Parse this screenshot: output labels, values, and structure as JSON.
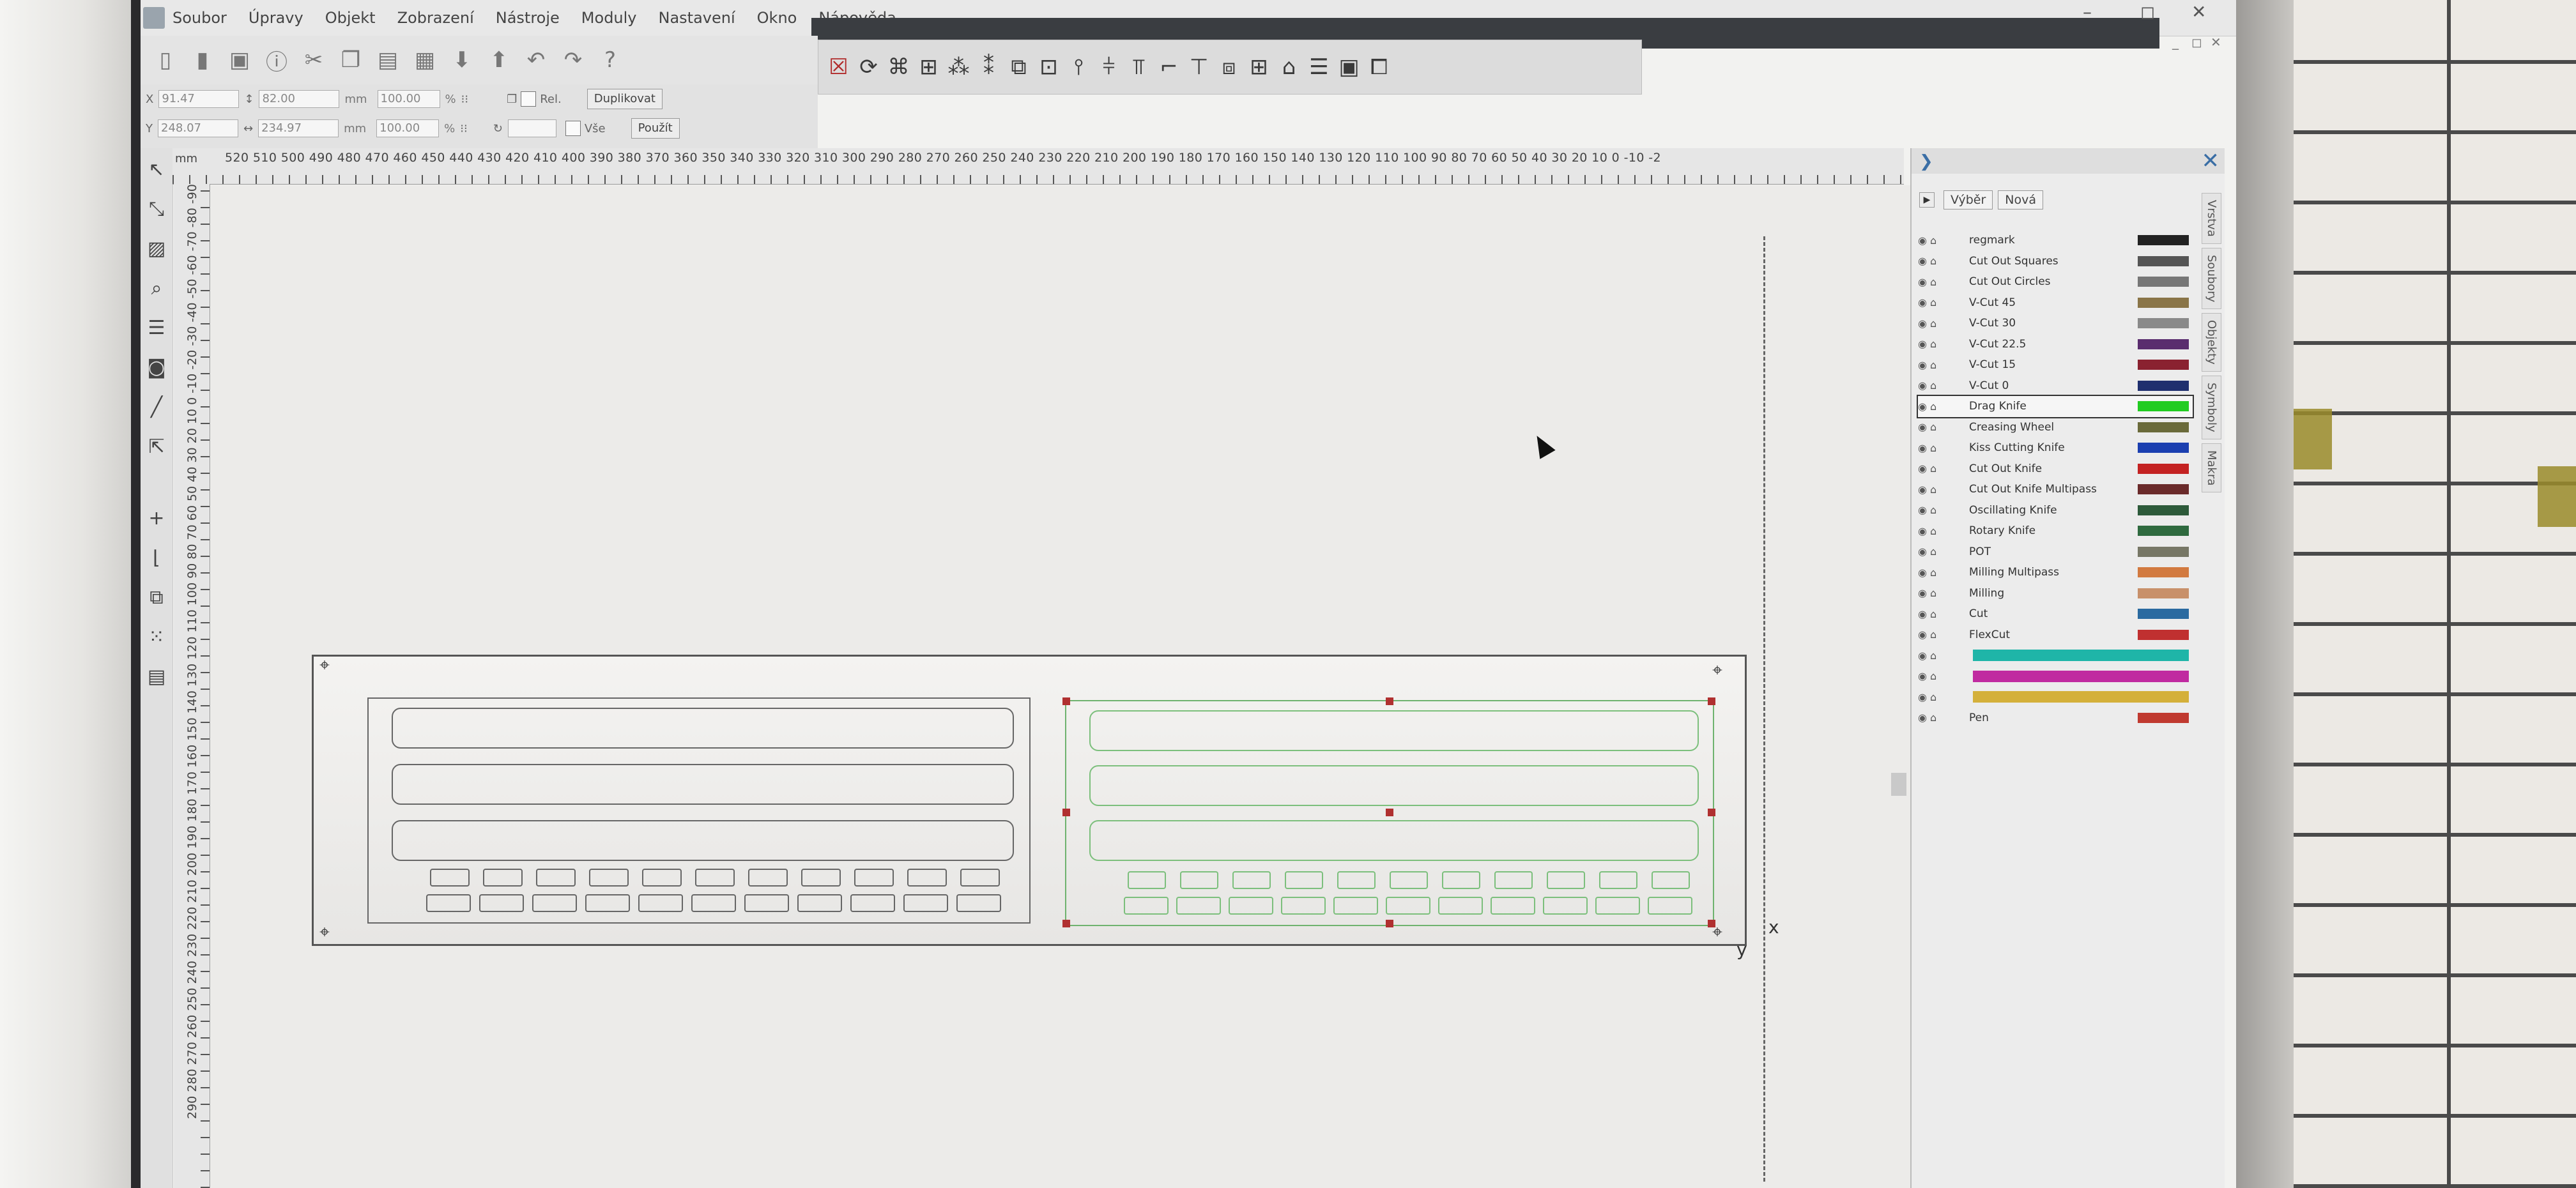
{
  "menu": [
    "Soubor",
    "Úpravy",
    "Objekt",
    "Zobrazení",
    "Nástroje",
    "Moduly",
    "Nastavení",
    "Okno",
    "Nápověda"
  ],
  "window_controls": [
    "–",
    "◻",
    "✕"
  ],
  "doc_controls": [
    "_",
    "◻",
    "✕"
  ],
  "props": {
    "x_label": "X",
    "x_value": "91.47",
    "y_label": "Y",
    "y_value": "248.07",
    "w_value": "82.00",
    "h_value": "234.97",
    "unit": "mm",
    "scale_w": "100.00",
    "scale_h": "100.00",
    "pct": "%",
    "rel_label": "Rel.",
    "all_label": "Vše",
    "duplicate_button": "Duplikovat",
    "apply_button": "Použít"
  },
  "ruler": {
    "unit": "mm",
    "h_numbers": "520 510 500 490 480 470 460 450 440 430 420 410 400 390 380 370 360 350 340 330 320 310 300 290 280 270 260 250 240 230 220 210 200 190 180 170 160 150 140 130 120 110 100 90 80 70 60 50 40 30 20 10 0 -10 -2",
    "v_numbers": "290 280 270 260 250 240 230 220 210 200 190 180 170 160 150 140 130 120 110 100 90 80 70 60 50 40 30 20 10 0 -10 -20 -30 -40 -50 -60 -70 -80 -90"
  },
  "canvas": {
    "axis_x": "x",
    "axis_y": "y"
  },
  "layers_panel": {
    "select_button": "Výběr",
    "new_button": "Nová",
    "tabs": [
      "Vrstva",
      "Soubory",
      "Objekty",
      "Symboly",
      "Makra"
    ],
    "layers": [
      {
        "name": "regmark",
        "color": "#222222"
      },
      {
        "name": "Cut Out Squares",
        "color": "#555555"
      },
      {
        "name": "Cut Out Circles",
        "color": "#777777"
      },
      {
        "name": "V-Cut 45",
        "color": "#8a7548"
      },
      {
        "name": "V-Cut 30",
        "color": "#8a8a8a"
      },
      {
        "name": "V-Cut 22.5",
        "color": "#5a2d6e"
      },
      {
        "name": "V-Cut 15",
        "color": "#8a2230"
      },
      {
        "name": "V-Cut 0",
        "color": "#1f2f6e"
      },
      {
        "name": "Drag Knife",
        "color": "#22cc22"
      },
      {
        "name": "Creasing Wheel",
        "color": "#6a6a3a"
      },
      {
        "name": "Kiss Cutting Knife",
        "color": "#1b3fb0"
      },
      {
        "name": "Cut Out Knife",
        "color": "#c42222"
      },
      {
        "name": "Cut Out Knife Multipass",
        "color": "#6a2a2a"
      },
      {
        "name": "Oscillating Knife",
        "color": "#2d5a3a"
      },
      {
        "name": "Rotary Knife",
        "color": "#2f6a3f"
      },
      {
        "name": "POT",
        "color": "#777766"
      },
      {
        "name": "Milling Multipass",
        "color": "#d27a40"
      },
      {
        "name": "Milling",
        "color": "#c8906a"
      },
      {
        "name": "Cut",
        "color": "#2a6aa0"
      },
      {
        "name": "FlexCut",
        "color": "#c03030"
      },
      {
        "name": "",
        "color": "#1fb5a8",
        "wide": true
      },
      {
        "name": "",
        "color": "#c02aa0",
        "wide": true
      },
      {
        "name": "",
        "color": "#d4b03a",
        "wide": true
      },
      {
        "name": "Pen",
        "color": "#c03a30"
      }
    ]
  }
}
